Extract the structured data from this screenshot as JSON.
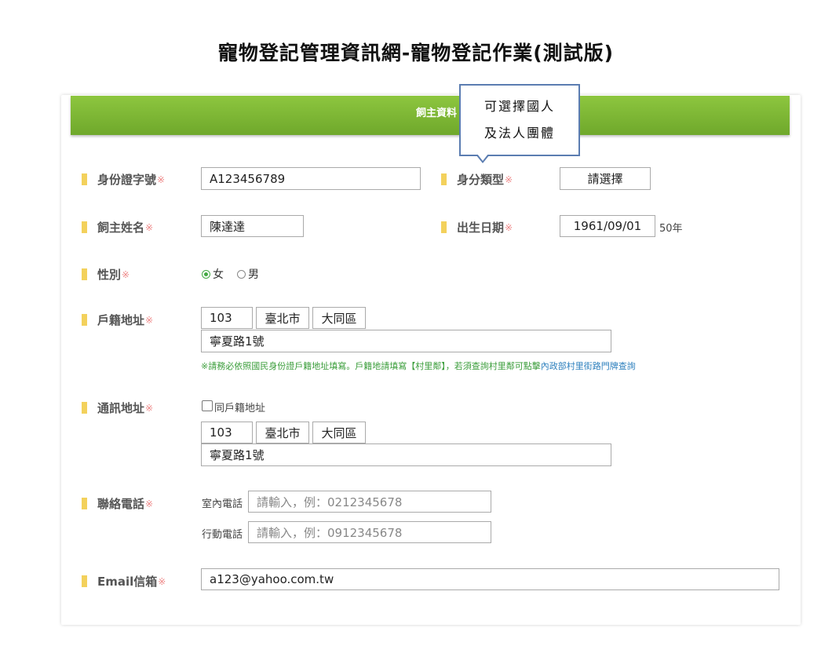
{
  "page_title": "寵物登記管理資訊網-寵物登記作業(測試版)",
  "section_title": "飼主資料",
  "callout": {
    "line1": "可選擇國人",
    "line2": "及法人團體"
  },
  "required_mark": "※",
  "fields": {
    "id_number": {
      "label": "身份證字號",
      "value": "A123456789"
    },
    "id_type": {
      "label": "身分類型",
      "value": "請選擇"
    },
    "owner_name": {
      "label": "飼主姓名",
      "value": "陳達達"
    },
    "birth_date": {
      "label": "出生日期",
      "value": "1961/09/01",
      "suffix": "50年"
    },
    "gender": {
      "label": "性別",
      "options": [
        "女",
        "男"
      ],
      "selected": "女"
    },
    "household_address": {
      "label": "戶籍地址",
      "zip": "103",
      "city": "臺北市",
      "district": "大同區",
      "street": "寧夏路1號",
      "note": "※請務必依照國民身份證戶籍地址填寫。戶籍地請填寫【村里鄰】，若須查詢村里鄰可點擊",
      "note_link": "內政部村里街路門牌查詢"
    },
    "mailing_address": {
      "label": "通訊地址",
      "same_as_label": "同戶籍地址",
      "zip": "103",
      "city": "臺北市",
      "district": "大同區",
      "street": "寧夏路1號"
    },
    "phone": {
      "label": "聯絡電話",
      "home_label": "室內電話",
      "home_placeholder": "請輸入，例：0212345678",
      "mobile_label": "行動電話",
      "mobile_placeholder": "請輸入，例：0912345678"
    },
    "email": {
      "label": "Email信箱",
      "value": "a123@yahoo.com.tw"
    }
  },
  "colors": {
    "header_green": "#7cb733",
    "label_bar": "#f3d15c",
    "required": "#e88888",
    "note_green": "#3a9d3a",
    "link_blue": "#2c7fbd"
  }
}
